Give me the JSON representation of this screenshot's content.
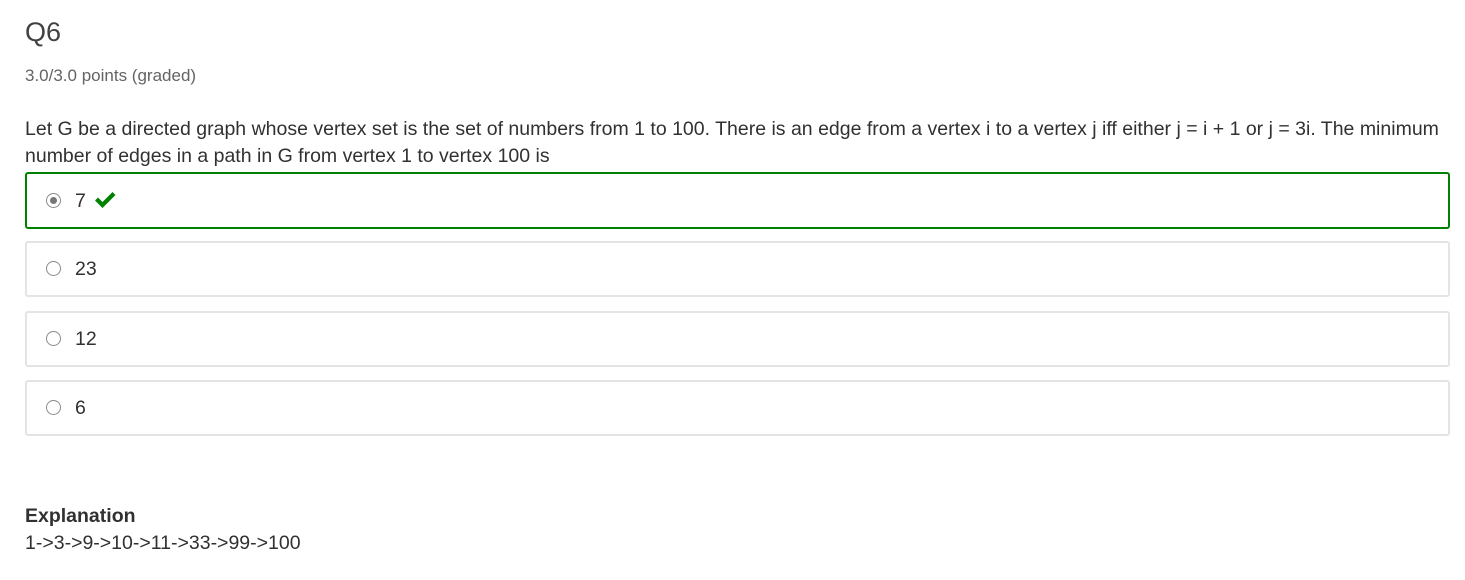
{
  "problem": {
    "title": "Q6",
    "points": "3.0/3.0 points (graded)",
    "question": "Let G be a directed graph whose vertex set is the set of numbers from 1 to 100. There is an edge from a vertex i to a vertex j iff either j = i + 1 or j = 3i. The minimum number of edges in a path in G from vertex 1 to vertex 100 is",
    "choices": [
      {
        "label": "7",
        "selected": true,
        "status": "correct",
        "status_icon": "checkmark-icon"
      },
      {
        "label": "23",
        "selected": false
      },
      {
        "label": "12",
        "selected": false
      },
      {
        "label": "6",
        "selected": false
      }
    ],
    "explanation": {
      "heading": "Explanation",
      "text": "1->3->9->10->11->33->99->100"
    }
  },
  "colors": {
    "correct_border": "#008100",
    "checkmark": "#008100",
    "choice_border": "#e4e4e4",
    "text": "#313131",
    "muted_text": "#646464"
  }
}
